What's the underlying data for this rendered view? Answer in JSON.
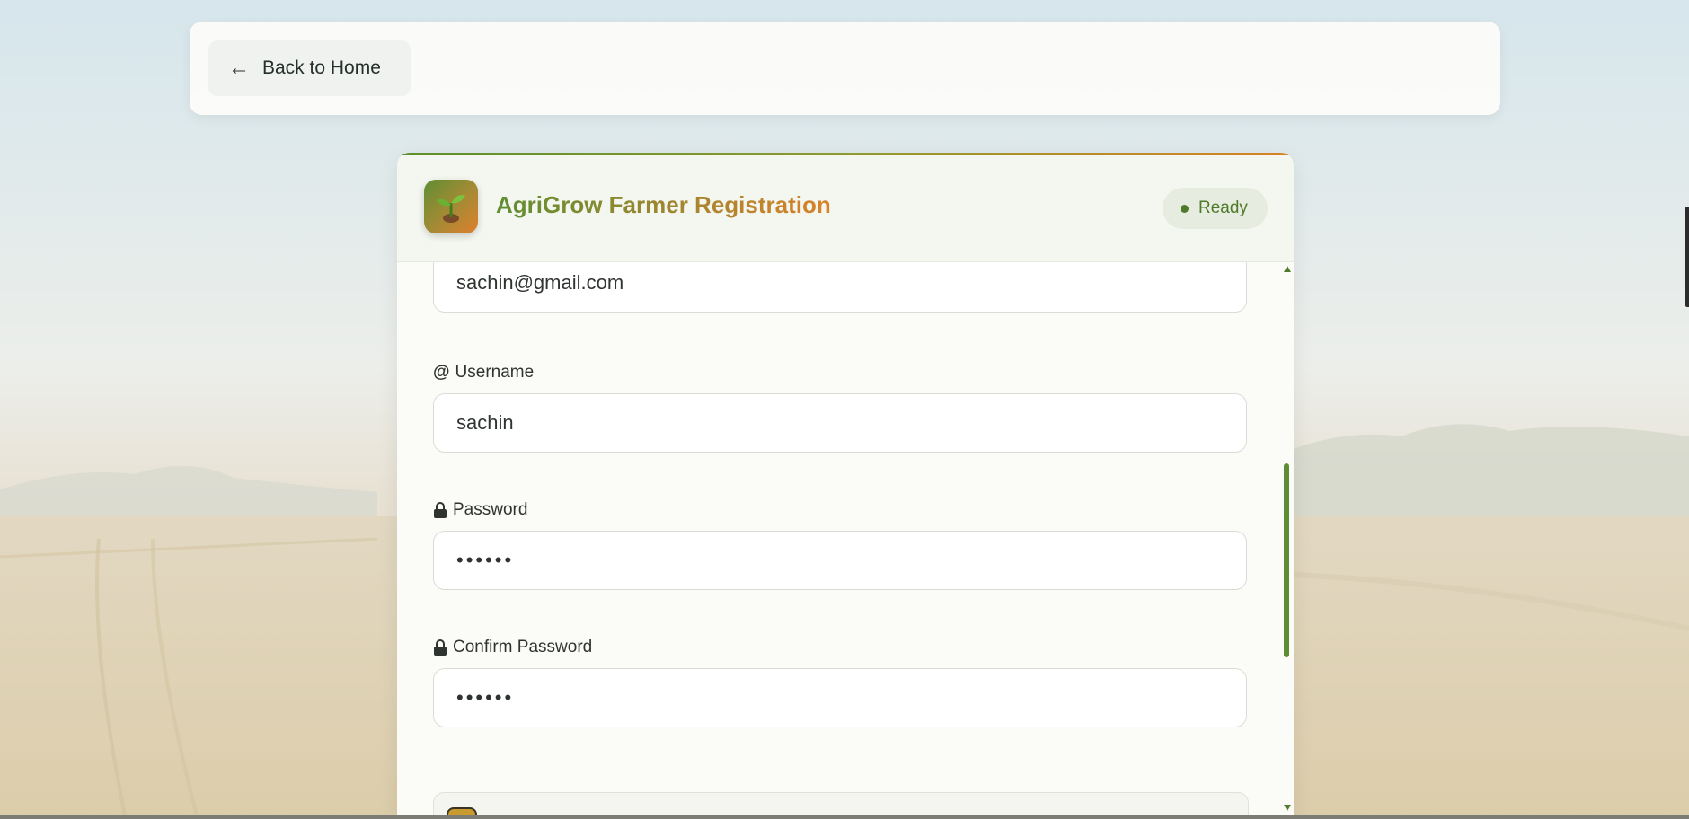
{
  "nav": {
    "back_arrow": "←",
    "back_label": "Back to Home"
  },
  "card": {
    "title": "AgriGrow Farmer Registration",
    "logo_icon": "sprout-icon",
    "status": "Ready"
  },
  "form": {
    "email": {
      "value": "sachin@gmail.com"
    },
    "username": {
      "icon": "@",
      "label": "Username",
      "value": "sachin"
    },
    "password": {
      "icon": "lock-icon",
      "label": "Password",
      "value": "••••••"
    },
    "confirm_password": {
      "icon": "lock-icon",
      "label": "Confirm Password",
      "value": "••••••"
    }
  },
  "colors": {
    "accent_green": "#5f8e32",
    "accent_orange": "#d9822a",
    "status_bg": "#e6ecdf"
  }
}
